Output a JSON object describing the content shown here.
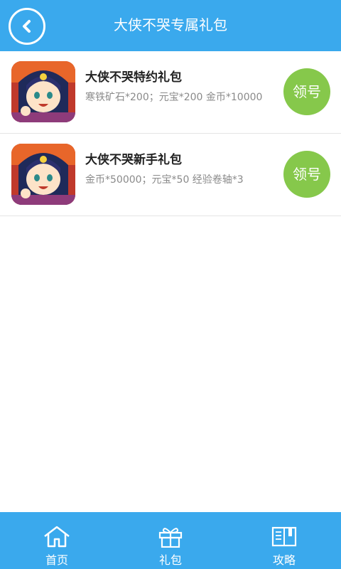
{
  "header": {
    "title": "大侠不哭专属礼包",
    "back_icon": "chevron-left-icon"
  },
  "gifts": [
    {
      "title": "大侠不哭特约礼包",
      "description": "寒铁矿石*200；元宝*200 金币*10000",
      "button_label": "领号",
      "icon": "game-avatar-icon"
    },
    {
      "title": "大侠不哭新手礼包",
      "description": "金币*50000；元宝*50 经验卷轴*3",
      "button_label": "领号",
      "icon": "game-avatar-icon"
    }
  ],
  "tabbar": {
    "items": [
      {
        "label": "首页",
        "icon": "home-icon"
      },
      {
        "label": "礼包",
        "icon": "gift-icon"
      },
      {
        "label": "攻略",
        "icon": "book-icon"
      }
    ]
  },
  "colors": {
    "primary": "#3aa9ed",
    "claim_button": "#86c84b",
    "title_text": "#222222",
    "desc_text": "#8a8a8a"
  }
}
